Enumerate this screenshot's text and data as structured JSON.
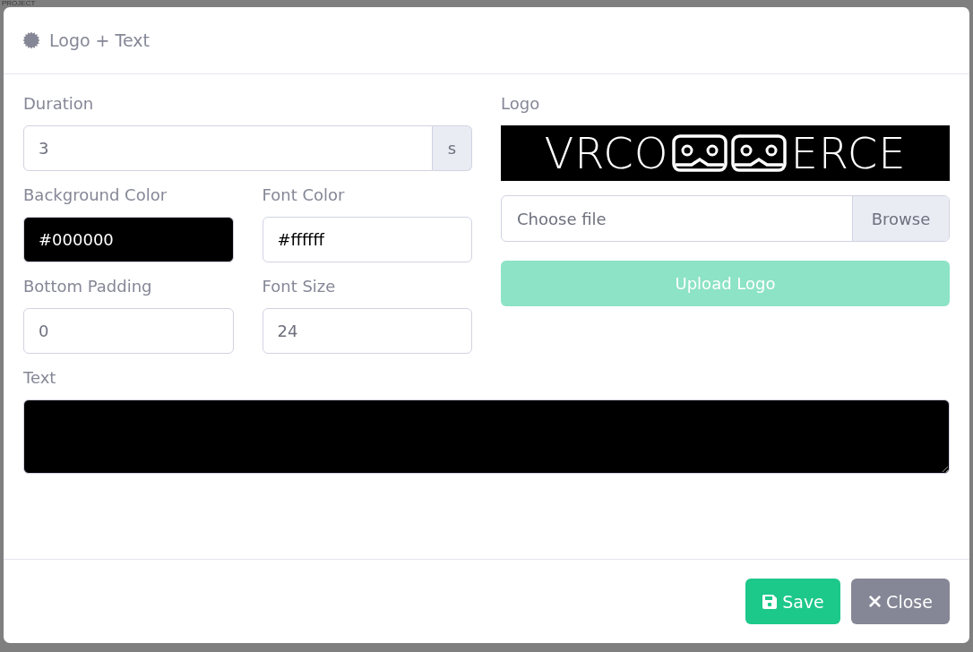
{
  "backdrop": {
    "text": "PROJECT"
  },
  "modal": {
    "title": "Logo + Text"
  },
  "fields": {
    "duration": {
      "label": "Duration",
      "value": "3",
      "unit": "s"
    },
    "background_color": {
      "label": "Background Color",
      "value": "#000000"
    },
    "font_color": {
      "label": "Font Color",
      "value": "#ffffff"
    },
    "bottom_padding": {
      "label": "Bottom Padding",
      "value": "0"
    },
    "font_size": {
      "label": "Font Size",
      "value": "24"
    },
    "text": {
      "label": "Text"
    }
  },
  "logo": {
    "label": "Logo",
    "text_before": "VRCO",
    "text_after": "ERCE"
  },
  "file_input": {
    "placeholder": "Choose file",
    "button": "Browse"
  },
  "upload_button": {
    "label": "Upload Logo",
    "disabled": true
  },
  "buttons": [
    {
      "kind": "save",
      "label": "Save"
    },
    {
      "kind": "close",
      "label": "Close"
    }
  ]
}
